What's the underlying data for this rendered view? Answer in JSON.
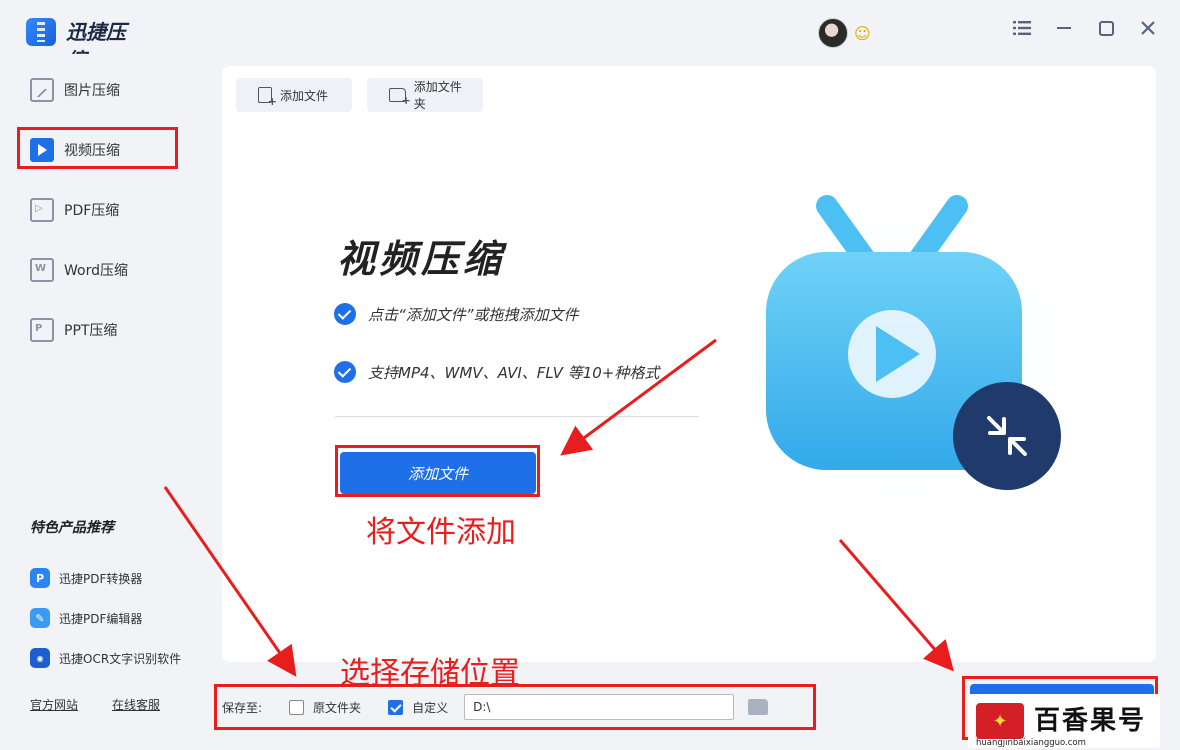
{
  "app": {
    "title": "迅捷压缩"
  },
  "sidebar": {
    "items": [
      {
        "label": "图片压缩",
        "icon": "image-file-icon"
      },
      {
        "label": "视频压缩",
        "icon": "video-file-icon",
        "active": true
      },
      {
        "label": "PDF压缩",
        "icon": "pdf-file-icon"
      },
      {
        "label": "Word压缩",
        "icon": "word-file-icon"
      },
      {
        "label": "PPT压缩",
        "icon": "ppt-file-icon"
      }
    ],
    "featured_title": "特色产品推荐",
    "featured": [
      {
        "label": "迅捷PDF转换器",
        "icon": "pdf-converter-icon"
      },
      {
        "label": "迅捷PDF编辑器",
        "icon": "pdf-editor-icon"
      },
      {
        "label": "迅捷OCR文字识别软件",
        "icon": "ocr-icon"
      }
    ],
    "links": {
      "website": "官方网站",
      "support": "在线客服"
    }
  },
  "toolbar": {
    "add_file": "添加文件",
    "add_folder": "添加文件夹"
  },
  "main": {
    "title": "视频压缩",
    "features": [
      "点击“添加文件”或拖拽添加文件",
      "支持MP4、WMV、AVI、FLV 等10+种格式"
    ],
    "add_button": "添加文件"
  },
  "annotations": {
    "add": "将文件添加",
    "save": "选择存储位置"
  },
  "save_bar": {
    "label": "保存至:",
    "original_folder": "原文件夹",
    "custom": "自定义",
    "path": "D:\\",
    "original_checked": false,
    "custom_checked": true
  },
  "watermark": {
    "brand": "百香果号",
    "url": "huangjinbaixiangguo.com"
  },
  "colors": {
    "accent": "#1e6fe8",
    "annotation": "#e81e1e",
    "tv_body": "#4cc0f2",
    "compress_badge": "#1f3a6b"
  }
}
